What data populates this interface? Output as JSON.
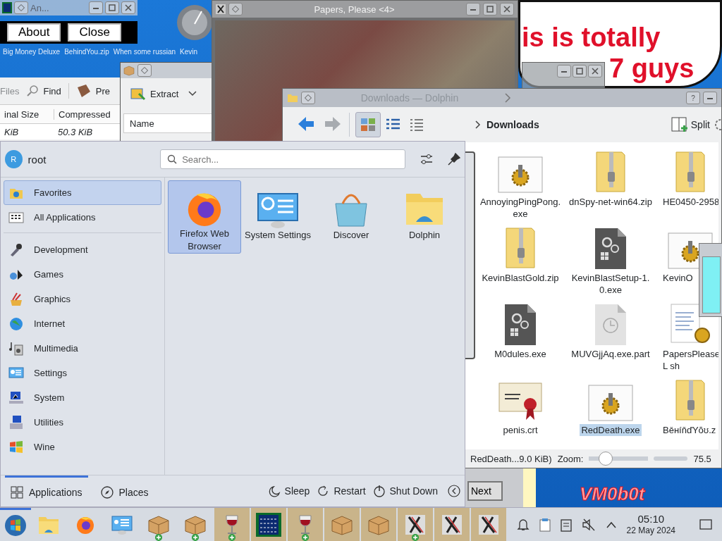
{
  "about_window": {
    "title": "An...",
    "buttons": [
      "About",
      "Close"
    ]
  },
  "desktop_icons": [
    {
      "label": "Big Money Deluxe"
    },
    {
      "label": "BehindYou.zip"
    },
    {
      "label": "When some russian"
    },
    {
      "label": "Kevin"
    }
  ],
  "archive_window_back": {
    "toolbar": [
      "Files",
      "Find",
      "Pre"
    ],
    "columns": [
      "inal Size",
      "Compressed"
    ],
    "cells": [
      "KiB",
      "50.3 KiB"
    ]
  },
  "archive_window": {
    "toolbar_button": "Extract",
    "column": "Name"
  },
  "game_window": {
    "title": "Papers, Please <4>"
  },
  "speech_bubble": {
    "lines": [
      "is is totally",
      "7 guys"
    ]
  },
  "file_manager": {
    "title": "Downloads — Dolphin",
    "breadcrumb": "Downloads",
    "split_button": "Split",
    "help_button": "?",
    "view_modes": [
      {
        "selected": true
      },
      {
        "selected": false
      },
      {
        "selected": false
      }
    ],
    "files": [
      {
        "name": "AnnoyingPingPong.exe",
        "kind": "program",
        "selected": false
      },
      {
        "name": "dnSpy-net-win64.zip",
        "kind": "archive",
        "selected": false
      },
      {
        "name": "HE0450-2958",
        "kind": "archive",
        "selected": false
      },
      {
        "name": "KevinBlastGold.zip",
        "kind": "archive",
        "selected": false
      },
      {
        "name": "KevinBlastSetup-1.0.exe",
        "kind": "executable",
        "selected": false
      },
      {
        "name": "KevinO",
        "kind": "program",
        "selected": false
      },
      {
        "name": "M0dules.exe",
        "kind": "executable",
        "selected": false
      },
      {
        "name": "MUVGjjAq.exe.part",
        "kind": "partial",
        "selected": false
      },
      {
        "name": "PapersPleaseL sh",
        "kind": "script",
        "selected": false
      },
      {
        "name": "penis.crt",
        "kind": "certificate",
        "selected": false
      },
      {
        "name": "RedDeath.exe",
        "kind": "program",
        "selected": true
      },
      {
        "name": "BěнíňďYŏʊ.z",
        "kind": "archive",
        "selected": false
      }
    ],
    "status": "RedDeath...9.0 KiB)",
    "zoom_label": "Zoom:",
    "zoom": {
      "level": 0.28
    },
    "free_space": "75.5"
  },
  "side_window": {
    "button": "Next"
  },
  "wallpaper_text": "VM0b0t",
  "start_menu": {
    "user": "root",
    "avatar_initial": "R",
    "search": {
      "placeholder": "Search..."
    },
    "pinned_categories": [
      {
        "label": "Favorites",
        "selected": true
      },
      {
        "label": "All Applications",
        "selected": false
      }
    ],
    "categories": [
      {
        "label": "Development",
        "selected": false
      },
      {
        "label": "Games",
        "selected": false
      },
      {
        "label": "Graphics",
        "selected": false
      },
      {
        "label": "Internet",
        "selected": false
      },
      {
        "label": "Multimedia",
        "selected": false
      },
      {
        "label": "Settings",
        "selected": false
      },
      {
        "label": "System",
        "selected": false
      },
      {
        "label": "Utilities",
        "selected": false
      },
      {
        "label": "Wine",
        "selected": false
      }
    ],
    "apps": [
      {
        "label": "Firefox Web Browser",
        "selected": true
      },
      {
        "label": "System Settings",
        "selected": false
      },
      {
        "label": "Discover",
        "selected": false
      },
      {
        "label": "Dolphin",
        "selected": false
      }
    ],
    "tabs": [
      {
        "label": "Applications",
        "selected": true
      },
      {
        "label": "Places",
        "selected": false
      }
    ],
    "power": [
      "Sleep",
      "Restart",
      "Shut Down"
    ]
  },
  "taskbar": {
    "tasks": [
      {
        "kind": "folder",
        "active": false,
        "badge": false
      },
      {
        "kind": "firefox",
        "active": false,
        "badge": false
      },
      {
        "kind": "settings",
        "active": false,
        "badge": false
      },
      {
        "kind": "archive",
        "active": false,
        "badge": true
      },
      {
        "kind": "archive",
        "active": false,
        "badge": true
      },
      {
        "kind": "wine",
        "active": true,
        "badge": true
      },
      {
        "kind": "grid",
        "active": true,
        "badge": false
      },
      {
        "kind": "wine",
        "active": true,
        "badge": true
      },
      {
        "kind": "archive",
        "active": true,
        "badge": false
      },
      {
        "kind": "archive",
        "active": true,
        "badge": false
      },
      {
        "kind": "x-app",
        "active": true,
        "badge": true
      },
      {
        "kind": "x-app",
        "active": true,
        "badge": false
      },
      {
        "kind": "x-app",
        "active": true,
        "badge": false
      }
    ],
    "time": "05:10",
    "date": "22 May 2024"
  }
}
